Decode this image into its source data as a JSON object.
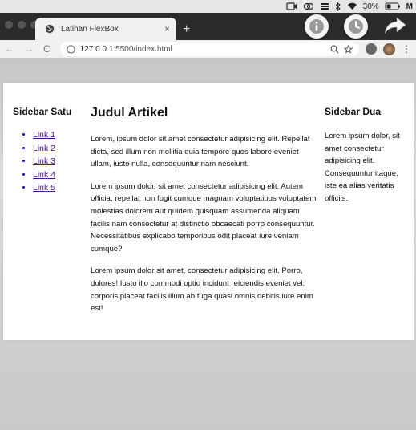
{
  "menubar": {
    "battery": "30%",
    "menu_letter": "M"
  },
  "browser": {
    "tab_title": "Latihan FlexBox",
    "tab_close": "×",
    "new_tab": "+",
    "url_host": "127.0.0.1",
    "url_rest": ":5500/index.html",
    "back": "←",
    "forward": "→",
    "reload": "C",
    "menu": "⋮"
  },
  "page": {
    "sidebar1": {
      "title": "Sidebar Satu",
      "links": [
        "Link 1",
        "Link 2",
        "Link 3",
        "Link 4",
        "Link 5"
      ]
    },
    "main": {
      "title": "Judul Artikel",
      "paragraphs": [
        "Lorem, ipsum dolor sit amet consectetur adipisicing elit. Repellat dicta, sed illum non mollitia quia tempore quos labore eveniet ullam, iusto nulla, consequuntur nam nesciunt.",
        "Lorem ipsum dolor, sit amet consectetur adipisicing elit. Autem officia, repellat non fugit cumque magnam voluptatibus voluptatem molestias dolorem aut quidem quisquam assumenda aliquam facilis nam consectetur at distinctio obcaecati porro consequuntur. Necessitatibus explicabo temporibus odit placeat iure veniam cumque?",
        "Lorem ipsum dolor sit amet, consectetur adipisicing elit. Porro, dolores! Iusto illo commodi optio incidunt reiciendis eveniet vel, corporis placeat facilis illum ab fuga quasi omnis debitis iure enim est!"
      ]
    },
    "sidebar2": {
      "title": "Sidebar Dua",
      "text": "Lorem ipsum dolor, sit amet consectetur adipisicing elit. Consequuntur itaque, iste ea alias veritatis officiis."
    }
  }
}
